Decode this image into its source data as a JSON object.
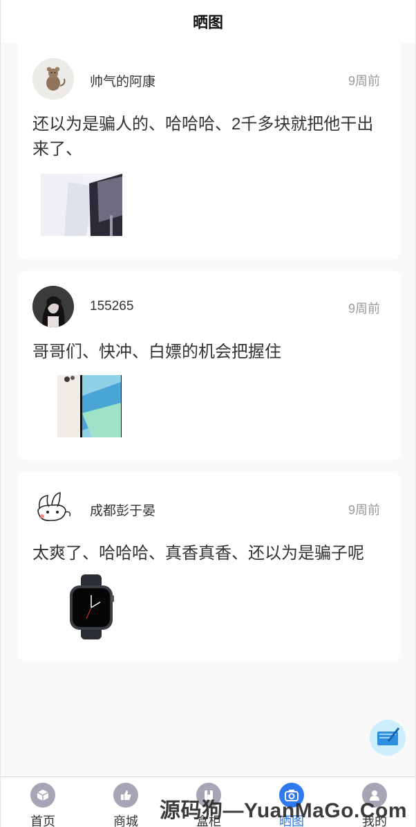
{
  "header": {
    "title": "晒图"
  },
  "posts": [
    {
      "username": "帅气的阿康",
      "time": "9周前",
      "text": "还以为是骗人的、哈哈哈、2千多块就把他干出来了、",
      "avatar_icon": "rat-avatar",
      "photo_icon": "imac-photo"
    },
    {
      "username": "155265",
      "time": "9周前",
      "text": "哥哥们、快冲、白嫖的机会把握住",
      "avatar_icon": "anime-avatar",
      "photo_icon": "iphone-photo"
    },
    {
      "username": "成都彭于晏",
      "time": "9周前",
      "text": "太爽了、哈哈哈、真香真香、还以为是骗子呢",
      "avatar_icon": "bunny-sketch-avatar",
      "photo_icon": "apple-watch-photo"
    }
  ],
  "fab": {
    "icon": "edit-icon"
  },
  "tabbar": {
    "tabs": [
      {
        "label": "首页",
        "icon": "cube-icon",
        "active": false
      },
      {
        "label": "商城",
        "icon": "thumb-icon",
        "active": false
      },
      {
        "label": "盒柜",
        "icon": "bookmark-icon",
        "active": false
      },
      {
        "label": "晒图",
        "icon": "camera-icon",
        "active": true
      },
      {
        "label": "我的",
        "icon": "user-icon",
        "active": false
      }
    ]
  },
  "watermark": "源码狗—YuanMaGo.Com",
  "colors": {
    "accent": "#2e78f0",
    "tab_icon": "#a7a4b6",
    "muted_text": "#999999"
  }
}
